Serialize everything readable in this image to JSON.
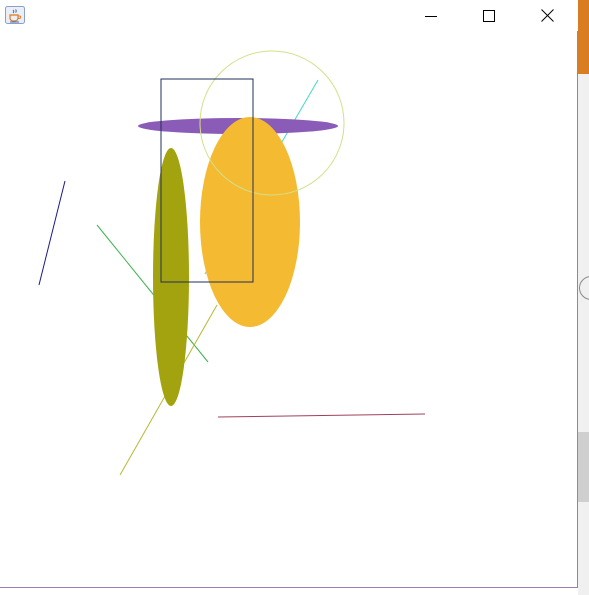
{
  "window": {
    "app_icon": "java-coffee-cup-icon",
    "controls": {
      "minimize_icon": "minimize-icon",
      "maximize_icon": "maximize-icon",
      "close_icon": "close-icon"
    }
  },
  "drawing": {
    "background": "#ffffff",
    "shapes": [
      {
        "kind": "line",
        "name": "navy-line",
        "color": "#1a1a8c"
      },
      {
        "kind": "line",
        "name": "green-line",
        "color": "#3cb44b"
      },
      {
        "kind": "line",
        "name": "cyan-line",
        "color": "#40d9c8"
      },
      {
        "kind": "line",
        "name": "olive-line",
        "color": "#b5b830"
      },
      {
        "kind": "line",
        "name": "maroon-line",
        "color": "#a0405a"
      },
      {
        "kind": "ellipse",
        "name": "purple-flat-ellipse",
        "color": "#8a5cb8",
        "filled": true
      },
      {
        "kind": "ellipse",
        "name": "olive-ellipse",
        "color": "#a3a30f",
        "filled": true
      },
      {
        "kind": "ellipse",
        "name": "orange-ellipse",
        "color": "#f4bb32",
        "filled": true
      },
      {
        "kind": "circle",
        "name": "light-green-circle",
        "color": "#d2e08a",
        "filled": false
      },
      {
        "kind": "rectangle",
        "name": "navy-rectangle",
        "color": "#1f2f5a",
        "filled": false
      }
    ]
  }
}
